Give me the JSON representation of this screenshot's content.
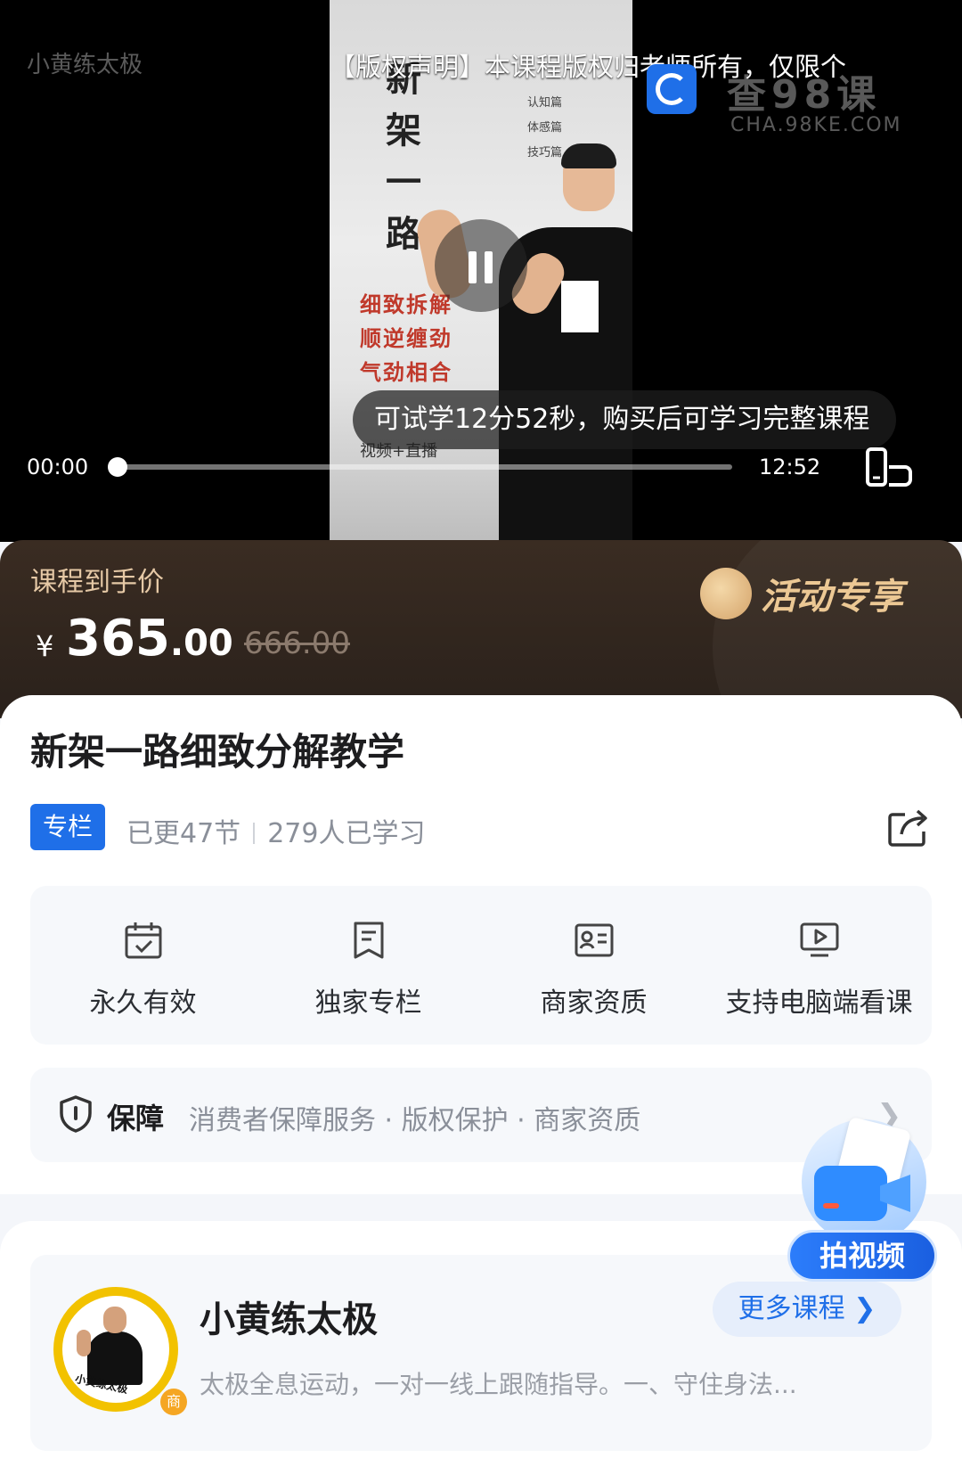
{
  "player": {
    "channel_name": "小黄练太极",
    "copyright_notice": "【版权声明】本课程版权归老师所有，仅限个",
    "watermark_text": "查98课",
    "watermark_sub": "CHA.98KE.COM",
    "poster": {
      "title_vertical": [
        "新",
        "架",
        "一",
        "路"
      ],
      "chapters": [
        "认知篇",
        "体感篇",
        "技巧篇"
      ],
      "red_lines": [
        "细致拆解",
        "顺逆缠劲",
        "气劲相合"
      ],
      "small_line": "视频+直播"
    },
    "trial_notice": "可试学12分52秒，购买后可学习完整课程",
    "current_time": "00:00",
    "total_time": "12:52",
    "progress": 0.0
  },
  "price": {
    "label": "课程到手价",
    "currency": "¥",
    "current_int": "365",
    "current_dec": ".00",
    "original": "666.00",
    "promo_text": "活动专享",
    "colors": {
      "banner": "#2f251e",
      "promo": "#ecc894"
    }
  },
  "course": {
    "title": "新架一路细致分解教学",
    "tag": "专栏",
    "updated": "已更47节",
    "learners": "279人已学习"
  },
  "features": [
    {
      "icon": "calendar-check-icon",
      "label": "永久有效"
    },
    {
      "icon": "bookmark-doc-icon",
      "label": "独家专栏"
    },
    {
      "icon": "id-card-icon",
      "label": "商家资质"
    },
    {
      "icon": "monitor-play-icon",
      "label": "支持电脑端看课"
    }
  ],
  "guarantee": {
    "title": "保障",
    "items": "消费者保障服务 · 版权保护 · 商家资质"
  },
  "shop": {
    "name": "小黄练太极",
    "avatar_text": "小黄练太极",
    "badge": "商",
    "description": "太极全息运动，一对一线上跟随指导。一、守住身法...",
    "more_label": "更多课程 ❯"
  },
  "float_button": {
    "label": "拍视频"
  },
  "accent_color": "#1f6fe8"
}
